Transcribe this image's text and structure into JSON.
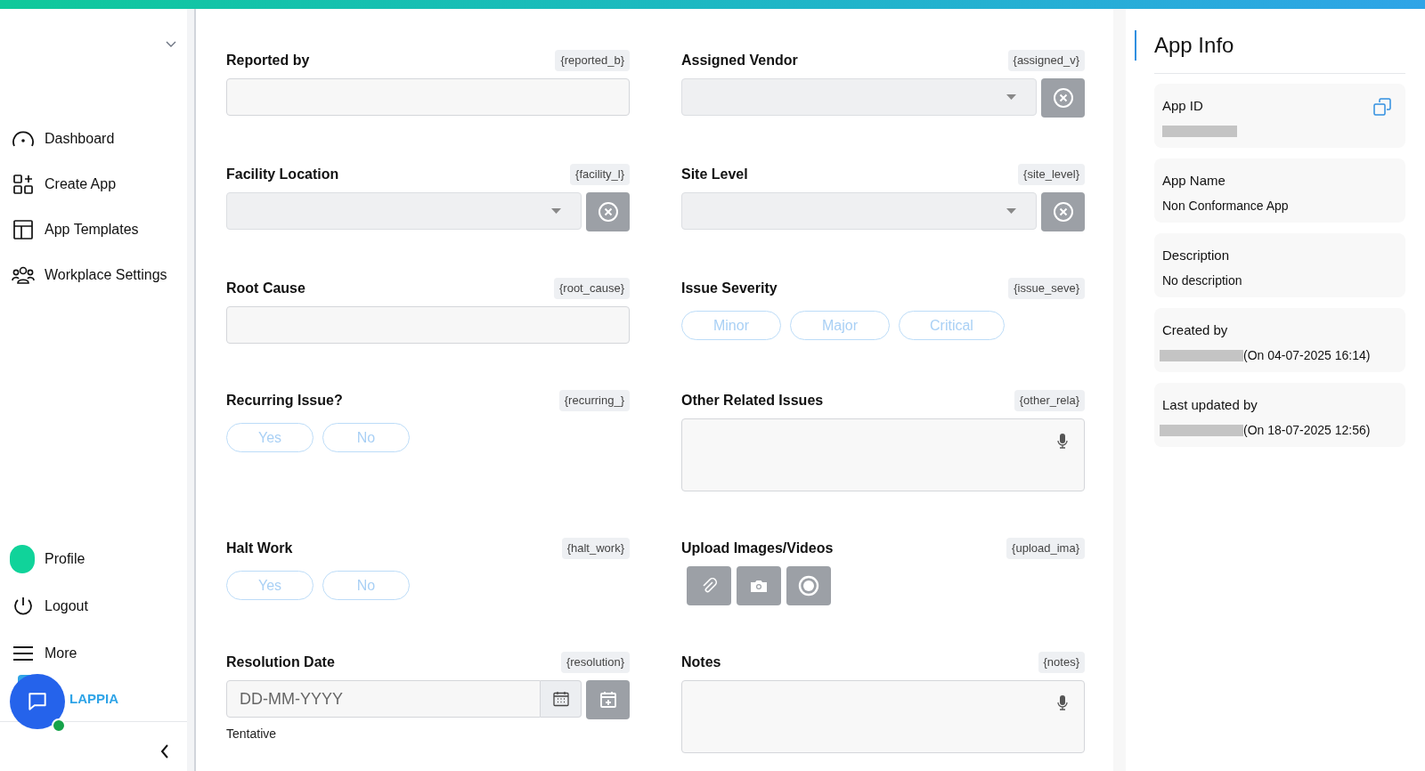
{
  "sidebar": {
    "items": [
      {
        "label": "Dashboard"
      },
      {
        "label": "Create App"
      },
      {
        "label": "App Templates"
      },
      {
        "label": "Workplace Settings"
      }
    ],
    "bottom_items": [
      {
        "label": "Profile"
      },
      {
        "label": "Logout"
      },
      {
        "label": "More"
      }
    ],
    "logo_text": "LAPPIA"
  },
  "form": {
    "fields": [
      {
        "kind": "text",
        "label": "Reported by",
        "tag": "{reported_b}"
      },
      {
        "kind": "select",
        "label": "Assigned Vendor",
        "tag": "{assigned_v}"
      },
      {
        "kind": "select",
        "label": "Facility Location",
        "tag": "{facility_l}"
      },
      {
        "kind": "select",
        "label": "Site Level",
        "tag": "{site_level}"
      },
      {
        "kind": "text",
        "label": "Root Cause",
        "tag": "{root_cause}"
      },
      {
        "kind": "choice",
        "label": "Issue Severity",
        "tag": "{issue_seve}",
        "options": [
          {
            "label": "Minor",
            "selected": false
          },
          {
            "label": "Major",
            "selected": false
          },
          {
            "label": "Critical",
            "selected": false
          }
        ]
      },
      {
        "kind": "choice",
        "label": "Recurring Issue?",
        "tag": "{recurring_}",
        "options": [
          {
            "label": "Yes",
            "selected": false
          },
          {
            "label": "No",
            "selected": false
          }
        ]
      },
      {
        "kind": "textarea",
        "label": "Other Related Issues",
        "tag": "{other_rela}"
      },
      {
        "kind": "choice",
        "label": "Halt Work",
        "tag": "{halt_work}",
        "options": [
          {
            "label": "Yes",
            "selected": false
          },
          {
            "label": "No",
            "selected": false
          }
        ]
      },
      {
        "kind": "upload",
        "label": "Upload Images/Videos",
        "tag": "{upload_ima}"
      },
      {
        "kind": "date",
        "label": "Resolution Date",
        "tag": "{resolution}",
        "placeholder": "DD-MM-YYYY",
        "note": "Tentative"
      },
      {
        "kind": "textarea",
        "label": "Notes",
        "tag": "{notes}"
      }
    ]
  },
  "app_info": {
    "title": "App Info",
    "cards": [
      {
        "label": "App ID",
        "redacted": true,
        "copy": true
      },
      {
        "label": "App Name",
        "value": "Non Conformance App"
      },
      {
        "label": "Description",
        "value": "No description"
      },
      {
        "label": "Created by",
        "redacted": true,
        "value": "(On 04-07-2025 16:14)"
      },
      {
        "label": "Last updated by",
        "redacted": true,
        "value": "(On 18-07-2025 12:56)"
      }
    ]
  }
}
